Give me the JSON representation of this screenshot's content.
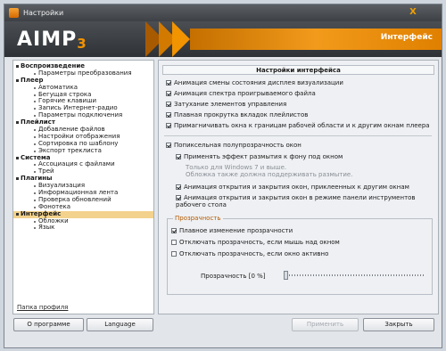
{
  "window": {
    "title": "Настройки",
    "close": "X"
  },
  "header": {
    "logo": "AIMP",
    "logo_version": "3",
    "section": "Интерфейс"
  },
  "sidebar": {
    "items": [
      {
        "label": "Воспроизведение",
        "level": "cat"
      },
      {
        "label": "Параметры преобразования",
        "level": "sub"
      },
      {
        "label": "Плеер",
        "level": "cat"
      },
      {
        "label": "Автоматика",
        "level": "sub"
      },
      {
        "label": "Бегущая строка",
        "level": "sub"
      },
      {
        "label": "Горячие клавиши",
        "level": "sub"
      },
      {
        "label": "Запись Интернет-радио",
        "level": "sub"
      },
      {
        "label": "Параметры подключения",
        "level": "sub"
      },
      {
        "label": "Плейлист",
        "level": "cat"
      },
      {
        "label": "Добавление файлов",
        "level": "sub"
      },
      {
        "label": "Настройки отображения",
        "level": "sub"
      },
      {
        "label": "Сортировка по шаблону",
        "level": "sub"
      },
      {
        "label": "Экспорт треклиста",
        "level": "sub"
      },
      {
        "label": "Система",
        "level": "cat"
      },
      {
        "label": "Ассоциация с файлами",
        "level": "sub"
      },
      {
        "label": "Трей",
        "level": "sub"
      },
      {
        "label": "Плагины",
        "level": "cat"
      },
      {
        "label": "Визуализация",
        "level": "sub"
      },
      {
        "label": "Информационная лента",
        "level": "sub"
      },
      {
        "label": "Проверка обновлений",
        "level": "sub"
      },
      {
        "label": "Фонотека",
        "level": "sub"
      },
      {
        "label": "Интерфейс",
        "level": "cat",
        "selected": true
      },
      {
        "label": "Обложки",
        "level": "sub"
      },
      {
        "label": "Язык",
        "level": "sub"
      }
    ],
    "profile_link": "Папка профиля"
  },
  "main": {
    "title": "Настройки интерфейса",
    "options": {
      "anim_display": {
        "label": "Анимация смены состояния дисплея визуализации",
        "checked": true
      },
      "anim_spectrum": {
        "label": "Анимация спектра проигрываемого файла",
        "checked": true
      },
      "fade_controls": {
        "label": "Затухание элементов управления",
        "checked": true
      },
      "smooth_scroll": {
        "label": "Плавная прокрутка вкладок плейлистов",
        "checked": true
      },
      "snap_windows": {
        "label": "Примагничивать окна к границам рабочей области и к другим окнам плеера",
        "checked": true
      },
      "window_transparency": {
        "label": "Попиксельная полупрозрачность окон",
        "checked": true
      },
      "blur_effect": {
        "label": "Применять эффект размытия к фону под окном",
        "checked": true
      },
      "anim_attached": {
        "label": "Анимация открытия и закрытия окон, приклеенных к другим окнам",
        "checked": true
      },
      "anim_taskbar": {
        "label": "Анимация открытия и закрытия окон в режиме панели инструментов рабочего стола",
        "checked": true
      }
    },
    "blur_note_1": "Только для Windows 7 и выше.",
    "blur_note_2": "Обложка также должна поддерживать размытие.",
    "transparency_group": {
      "legend": "Прозрачность",
      "smooth": {
        "label": "Плавное изменение прозрачности",
        "checked": true
      },
      "disable_hover": {
        "label": "Отключать прозрачность, если мышь над окном",
        "checked": false
      },
      "disable_active": {
        "label": "Отключать прозрачность, если окно активно",
        "checked": false
      },
      "slider_label": "Прозрачность [0 %]",
      "slider_value": 0
    }
  },
  "buttons": {
    "about": "О программе",
    "language": "Language",
    "apply": "Применить",
    "close": "Закрыть"
  },
  "colors": {
    "accent": "#f29300",
    "selection": "#f3d28d",
    "header": "#3d4145"
  }
}
